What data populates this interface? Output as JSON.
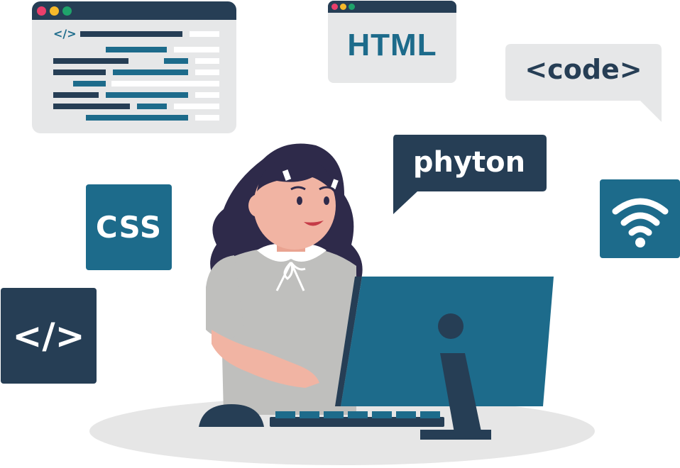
{
  "colors": {
    "navy": "#263e55",
    "teal": "#1d6b8b",
    "light_gray": "#e6e7e8",
    "floor": "#e5e5e5",
    "skin": "#f1b4a3",
    "hair": "#2e2a4a",
    "shirt": "#bfbfbd",
    "dot_red": "#ea3f6b",
    "dot_yellow": "#f6b92b",
    "dot_green": "#1fa36b"
  },
  "code_window": {
    "tag": "</>"
  },
  "html_window": {
    "label": "HTML"
  },
  "code_bubble": {
    "label": "<code>"
  },
  "phyton_bubble": {
    "label": "phyton"
  },
  "css_tile": {
    "label": "CSS"
  },
  "tag_tile": {
    "label": "</>"
  },
  "icons": {
    "wifi": "wifi-icon",
    "mouse": "mouse-icon",
    "keyboard": "keyboard-icon",
    "monitor": "monitor-icon"
  }
}
